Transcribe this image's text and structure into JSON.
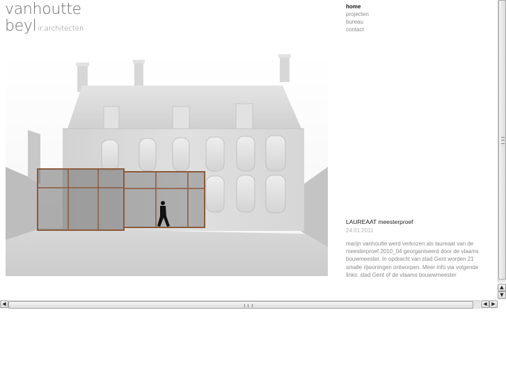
{
  "brand": {
    "line1": "vanhoutte",
    "line2": "beyl",
    "subtitle": "ir.architecten"
  },
  "nav": {
    "items": [
      {
        "label": "home",
        "active": true
      },
      {
        "label": "projecten",
        "active": false
      },
      {
        "label": "bureau",
        "active": false
      },
      {
        "label": "contact",
        "active": false
      }
    ]
  },
  "news": {
    "title": "LAUREAAT meesterproef",
    "date": "24.01.2011",
    "body": "marijn vanhoutte werd verkozen als laureaat van de meesterproef 2010_04 georganiseerd door de vlaams bouwmeester. In opdracht van stad Gent worden 21 smalle rijwoningen ontworpen. Meer info via volgende links: stad Gent of de vlaams bouwwmeester"
  },
  "scrollbars": {
    "up_arrow": "▲",
    "down_arrow": "▼",
    "left_arrow": "◀",
    "right_arrow": "▶"
  }
}
